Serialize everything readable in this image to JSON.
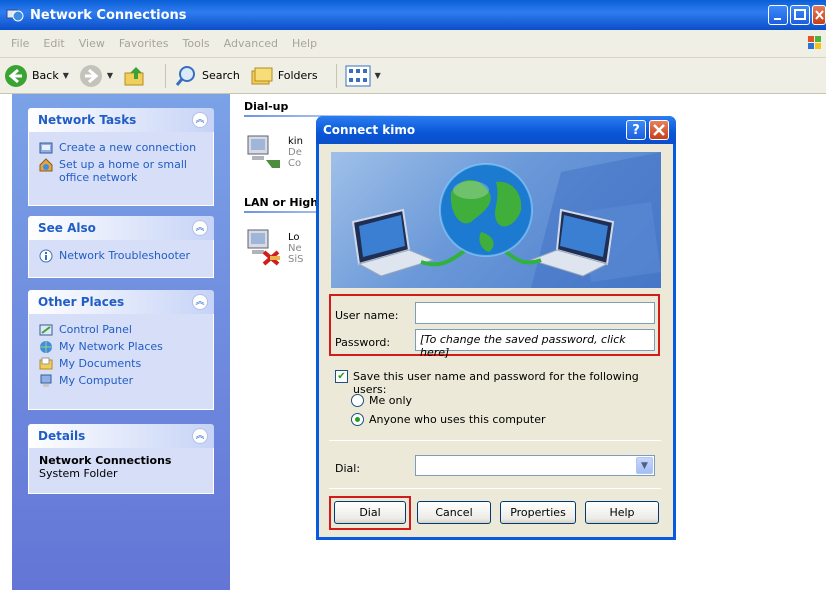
{
  "window": {
    "title": "Network Connections"
  },
  "menu": [
    "File",
    "Edit",
    "View",
    "Favorites",
    "Tools",
    "Advanced",
    "Help"
  ],
  "toolbar": {
    "back_label": "Back",
    "search_label": "Search",
    "folders_label": "Folders"
  },
  "taskpane": {
    "network_tasks": {
      "title": "Network Tasks",
      "items": [
        "Create a new connection",
        "Set up a home or small office network"
      ]
    },
    "see_also": {
      "title": "See Also",
      "items": [
        "Network Troubleshooter"
      ]
    },
    "other_places": {
      "title": "Other Places",
      "items": [
        "Control Panel",
        "My Network Places",
        "My Documents",
        "My Computer"
      ]
    },
    "details": {
      "title": "Details",
      "name": "Network Connections",
      "type": "System Folder"
    }
  },
  "content": {
    "dialup_header": "Dial-up",
    "lan_header": "LAN or High-",
    "dialup_item": {
      "name": "kin",
      "line2": "De",
      "line3": "Co"
    },
    "lan_item": {
      "name": "Lo",
      "line2": "Ne",
      "line3": "SiS"
    }
  },
  "dialog": {
    "title": "Connect kimo",
    "help_glyph": "?",
    "username_label": "User name:",
    "username_value": "",
    "password_label": "Password:",
    "password_value": "[To change the saved password, click here]",
    "save_label": "Save this user name and password for the following users:",
    "save_checked": true,
    "me_only_label": "Me only",
    "anyone_label": "Anyone who uses this computer",
    "selected_option": "anyone",
    "dial_label": "Dial:",
    "dial_value": "",
    "buttons": {
      "dial": "Dial",
      "cancel": "Cancel",
      "properties": "Properties",
      "help": "Help"
    }
  },
  "colors": {
    "title_bar": "#0a5fd6",
    "task_pane": "#7ba2e7",
    "link": "#215dc6",
    "highlight": "#d21c1c"
  }
}
